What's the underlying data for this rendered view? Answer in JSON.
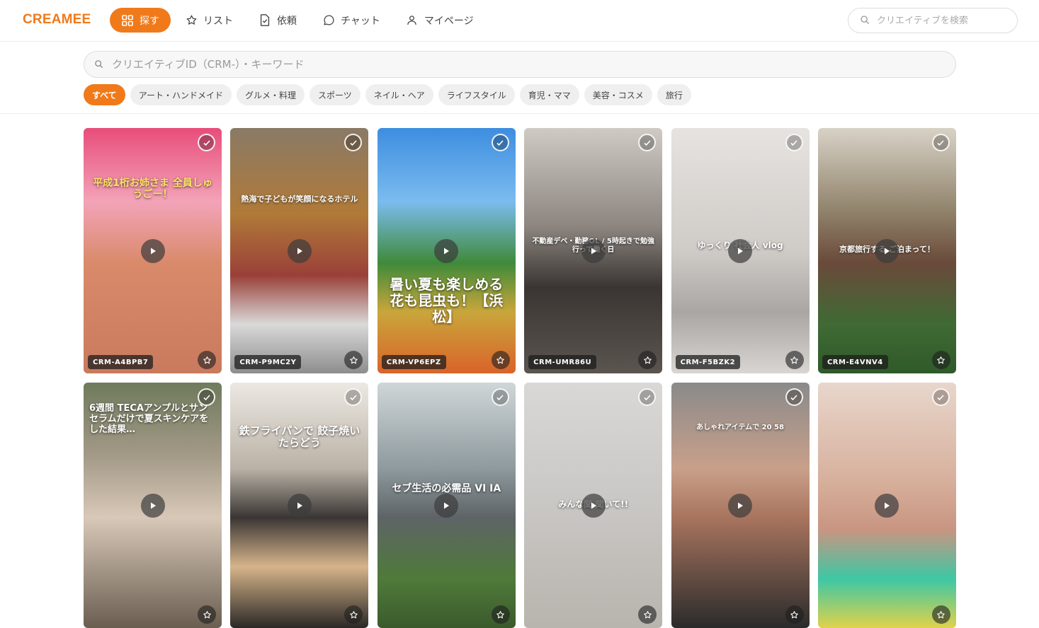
{
  "app": {
    "logo": "CREAMEE"
  },
  "nav": [
    {
      "label": "探す",
      "icon": "grid-icon",
      "active": true
    },
    {
      "label": "リスト",
      "icon": "star-icon",
      "active": false
    },
    {
      "label": "依頼",
      "icon": "document-check-icon",
      "active": false
    },
    {
      "label": "チャット",
      "icon": "chat-bubble-icon",
      "active": false
    },
    {
      "label": "マイページ",
      "icon": "user-icon",
      "active": false
    }
  ],
  "top_search": {
    "placeholder": "クリエイティブを検索"
  },
  "main_search": {
    "placeholder": "クリエイティブID（CRM-）・キーワード"
  },
  "categories": [
    "すべて",
    "アート・ハンドメイド",
    "グルメ・料理",
    "スポーツ",
    "ネイル・ヘア",
    "ライフスタイル",
    "育児・ママ",
    "美容・コスメ",
    "旅行"
  ],
  "active_category": "すべて",
  "colors": {
    "accent": "#f07a1a"
  },
  "cards": [
    {
      "id": "CRM-A4BPB7",
      "caption": "平成1桁お姉さま 全員しゅうごー！"
    },
    {
      "id": "CRM-P9MC2Y",
      "caption": "熱海で子どもが笑顔になるホテル"
    },
    {
      "id": "CRM-VP6EPZ",
      "caption": "暑い夏も楽しめる 花も昆虫も！【浜松】"
    },
    {
      "id": "CRM-UMR86U",
      "caption": "不動産デベ・勤務OL / 5時起きで勉強 行って働く日"
    },
    {
      "id": "CRM-F5BZK2",
      "caption": "ゆっくり 社会人 vlog"
    },
    {
      "id": "CRM-E4VNV4",
      "caption": "京都旅行する ご泊まって！"
    },
    {
      "id": "",
      "caption": "6週間 TECAアンプルとサンセラムだけで夏スキンケアをした結果…"
    },
    {
      "id": "",
      "caption": "鉄フライパンで 餃子焼いたらどう"
    },
    {
      "id": "",
      "caption": "セブ生活の必需品 VI IA"
    },
    {
      "id": "",
      "caption": "みんな聞 聞いて!!"
    },
    {
      "id": "",
      "caption": "あしゃれアイテムで 20 58"
    },
    {
      "id": "",
      "caption": ""
    }
  ]
}
